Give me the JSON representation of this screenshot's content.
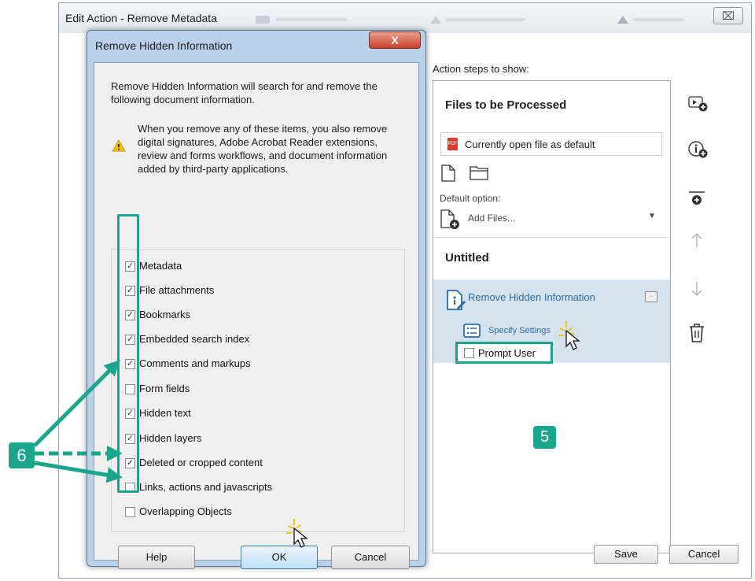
{
  "outer_window": {
    "title": "Edit Action - Remove Metadata",
    "close_glyph": "⌧",
    "steps_label": "Action steps to show:",
    "files_title": "Files to be Processed",
    "files_select": "Currently open file as default",
    "default_label": "Default option:",
    "add_files": "Add Files...",
    "untitled_title": "Untitled",
    "step_label": "Remove Hidden Information",
    "specify_settings": "Specify Settings",
    "prompt_user": "Prompt User",
    "save": "Save",
    "cancel": "Cancel",
    "side_tools": [
      "add-step-icon",
      "add-instruction-icon",
      "add-divider-icon",
      "move-up-icon",
      "move-down-icon",
      "delete-icon"
    ]
  },
  "dialog": {
    "title": "Remove Hidden Information",
    "close_glyph": "X",
    "intro": "Remove Hidden Information will search for and remove the following document information.",
    "warning": "When you remove any of these items, you also remove digital signatures, Adobe Acrobat Reader extensions, review and forms workflows, and document information added by third-party applications.",
    "options": [
      {
        "label": "Metadata",
        "checked": true
      },
      {
        "label": "File attachments",
        "checked": true
      },
      {
        "label": "Bookmarks",
        "checked": true
      },
      {
        "label": "Embedded search index",
        "checked": true
      },
      {
        "label": "Comments and markups",
        "checked": true
      },
      {
        "label": "Form fields",
        "checked": false
      },
      {
        "label": "Hidden text",
        "checked": true
      },
      {
        "label": "Hidden layers",
        "checked": true
      },
      {
        "label": "Deleted or cropped content",
        "checked": true
      },
      {
        "label": "Links, actions and javascripts",
        "checked": false
      },
      {
        "label": "Overlapping Objects",
        "checked": false
      }
    ],
    "help": "Help",
    "ok": "OK",
    "cancel": "Cancel"
  },
  "annotations": {
    "badge_6": "6",
    "badge_5": "5"
  },
  "colors": {
    "accent": "#1aa68c",
    "link": "#2d6da3",
    "selected_row": "#d5e3ee",
    "dialog_frame": "#b9d1ea"
  }
}
